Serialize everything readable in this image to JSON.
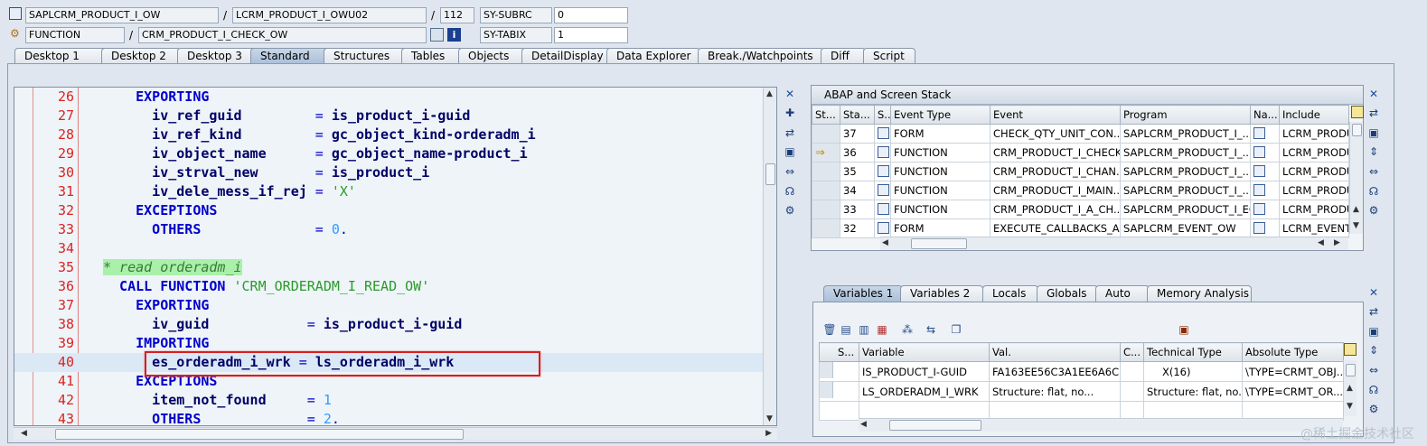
{
  "header": {
    "row1": {
      "program": "SAPLCRM_PRODUCT_I_OW",
      "include": "LCRM_PRODUCT_I_OWU02",
      "line": "112",
      "sysfield": "SY-SUBRC",
      "sysvalue": "0"
    },
    "row2": {
      "type": "FUNCTION",
      "name": "CRM_PRODUCT_I_CHECK_OW",
      "sysfield": "SY-TABIX",
      "sysvalue": "1"
    },
    "separator": "/"
  },
  "tabs": [
    "Desktop 1",
    "Desktop 2",
    "Desktop 3",
    "Standard",
    "Structures",
    "Tables",
    "Objects",
    "DetailDisplay",
    "Data Explorer",
    "Break./Watchpoints",
    "Diff",
    "Script"
  ],
  "active_tab": "Standard",
  "editor": {
    "lines": [
      {
        "n": "26",
        "parts": [
          [
            "kw",
            "    EXPORTING"
          ]
        ]
      },
      {
        "n": "27",
        "parts": [
          [
            "id",
            "      iv_ref_guid"
          ],
          [
            "op",
            "         = "
          ],
          [
            "id",
            "is_product_i-guid"
          ]
        ]
      },
      {
        "n": "28",
        "parts": [
          [
            "id",
            "      iv_ref_kind"
          ],
          [
            "op",
            "         = "
          ],
          [
            "id",
            "gc_object_kind-orderadm_i"
          ]
        ]
      },
      {
        "n": "29",
        "parts": [
          [
            "id",
            "      iv_object_name"
          ],
          [
            "op",
            "      = "
          ],
          [
            "id",
            "gc_object_name-product_i"
          ]
        ]
      },
      {
        "n": "30",
        "parts": [
          [
            "id",
            "      iv_strval_new"
          ],
          [
            "op",
            "       = "
          ],
          [
            "id",
            "is_product_i"
          ]
        ]
      },
      {
        "n": "31",
        "parts": [
          [
            "id",
            "      iv_dele_mess_if_rej"
          ],
          [
            "op",
            " = "
          ],
          [
            "str",
            "'X'"
          ]
        ]
      },
      {
        "n": "32",
        "parts": [
          [
            "kw",
            "    EXCEPTIONS"
          ]
        ]
      },
      {
        "n": "33",
        "parts": [
          [
            "kw",
            "      OTHERS"
          ],
          [
            "op",
            "              = "
          ],
          [
            "num",
            "0"
          ],
          [
            "op",
            "."
          ]
        ]
      },
      {
        "n": "34",
        "parts": []
      },
      {
        "n": "35",
        "parts": [
          [
            "cmt",
            "* read orderadm_i"
          ]
        ]
      },
      {
        "n": "36",
        "parts": [
          [
            "kw",
            "  CALL FUNCTION "
          ],
          [
            "str",
            "'CRM_ORDERADM_I_READ_OW'"
          ]
        ]
      },
      {
        "n": "37",
        "parts": [
          [
            "kw",
            "    EXPORTING"
          ]
        ]
      },
      {
        "n": "38",
        "parts": [
          [
            "id",
            "      iv_guid"
          ],
          [
            "op",
            "            = "
          ],
          [
            "id",
            "is_product_i-guid"
          ]
        ]
      },
      {
        "n": "39",
        "parts": [
          [
            "kw",
            "    IMPORTING"
          ]
        ]
      },
      {
        "n": "40",
        "parts": [
          [
            "id",
            "      es_orderadm_i_wrk"
          ],
          [
            "op",
            " = "
          ],
          [
            "id",
            "ls_orderadm_i_wrk"
          ]
        ]
      },
      {
        "n": "41",
        "parts": [
          [
            "kw",
            "    EXCEPTIONS"
          ]
        ]
      },
      {
        "n": "42",
        "parts": [
          [
            "id",
            "      item_not_found"
          ],
          [
            "op",
            "     = "
          ],
          [
            "num",
            "1"
          ]
        ]
      },
      {
        "n": "43",
        "parts": [
          [
            "kw",
            "      OTHERS"
          ],
          [
            "op",
            "             = "
          ],
          [
            "num",
            "2"
          ],
          [
            "op",
            "."
          ]
        ]
      }
    ]
  },
  "stack": {
    "title": "ABAP and Screen Stack",
    "columns": [
      "St...",
      "Sta...",
      "S...",
      "Event Type",
      "Event",
      "Program",
      "Na...",
      "Include"
    ],
    "rows": [
      {
        "level": "37",
        "type": "FORM",
        "event": "CHECK_QTY_UNIT_CON...",
        "program": "SAPLCRM_PRODUCT_I_...",
        "include": "LCRM_PRODU",
        "current": false
      },
      {
        "level": "36",
        "type": "FUNCTION",
        "event": "CRM_PRODUCT_I_CHECK...",
        "program": "SAPLCRM_PRODUCT_I_...",
        "include": "LCRM_PRODU",
        "current": true
      },
      {
        "level": "35",
        "type": "FUNCTION",
        "event": "CRM_PRODUCT_I_CHAN...",
        "program": "SAPLCRM_PRODUCT_I_...",
        "include": "LCRM_PRODU",
        "current": false
      },
      {
        "level": "34",
        "type": "FUNCTION",
        "event": "CRM_PRODUCT_I_MAIN...",
        "program": "SAPLCRM_PRODUCT_I_...",
        "include": "LCRM_PRODU",
        "current": false
      },
      {
        "level": "33",
        "type": "FUNCTION",
        "event": "CRM_PRODUCT_I_A_CH...",
        "program": "SAPLCRM_PRODUCT_I_EC",
        "include": "LCRM_PRODU",
        "current": false
      },
      {
        "level": "32",
        "type": "FORM",
        "event": "EXECUTE_CALLBACKS_A...",
        "program": "SAPLCRM_EVENT_OW",
        "include": "LCRM_EVENT",
        "current": false
      }
    ]
  },
  "vars": {
    "tabs": [
      "Variables 1",
      "Variables 2",
      "Locals",
      "Globals",
      "Auto",
      "Memory Analysis"
    ],
    "active_tab": "Variables 1",
    "columns": [
      "S...",
      "Variable",
      "Val.",
      "C...",
      "Technical Type",
      "Absolute Type"
    ],
    "rows": [
      {
        "variable": "IS_PRODUCT_I-GUID",
        "value": "FA163EE56C3A1EE6A6C...",
        "tech": "X(16)",
        "abs": "\\TYPE=CRMT_OBJ..."
      },
      {
        "variable": "LS_ORDERADM_I_WRK",
        "value": "Structure: flat, no...",
        "tech": "Structure: flat, no...",
        "abs": "\\TYPE=CRMT_OR..."
      }
    ]
  },
  "watermark": "@稀土掘金技术社区",
  "colors": {
    "highlight_box": "#d42020",
    "keyword": "#0000cc",
    "line_number": "#dd2222",
    "comment_bg": "#a9f0a9"
  }
}
